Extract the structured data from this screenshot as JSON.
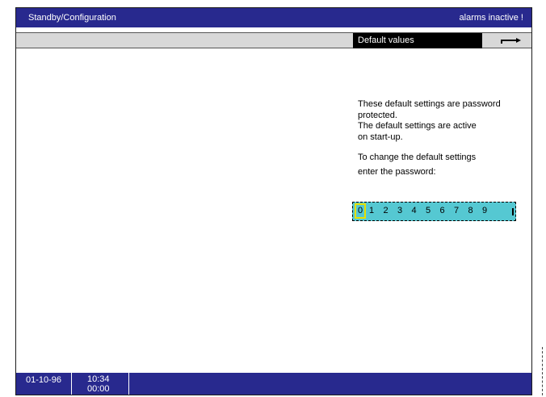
{
  "header": {
    "title": "Standby/Configuration",
    "alarm_status": "alarms inactive !"
  },
  "menu": {
    "tab_label": "Default values",
    "return_icon": "return-arrow-icon"
  },
  "info": {
    "line1": "These default settings are password",
    "line2": "protected.",
    "line3": "The default settings are active",
    "line4": "on start-up.",
    "line5": "To change the default settings",
    "line6": "enter the password:"
  },
  "password_selector": {
    "digits": [
      "0",
      "1",
      "2",
      "3",
      "4",
      "5",
      "6",
      "7",
      "8",
      "9"
    ],
    "selected_index": 0,
    "selected_color": "#e6e000",
    "background_color": "#55c8d2"
  },
  "status": {
    "date": "01-10-96",
    "time": "10:34",
    "elapsed": "00:00"
  },
  "colors": {
    "title_bg": "#28298e",
    "menu_bg": "#d8d8d8"
  }
}
